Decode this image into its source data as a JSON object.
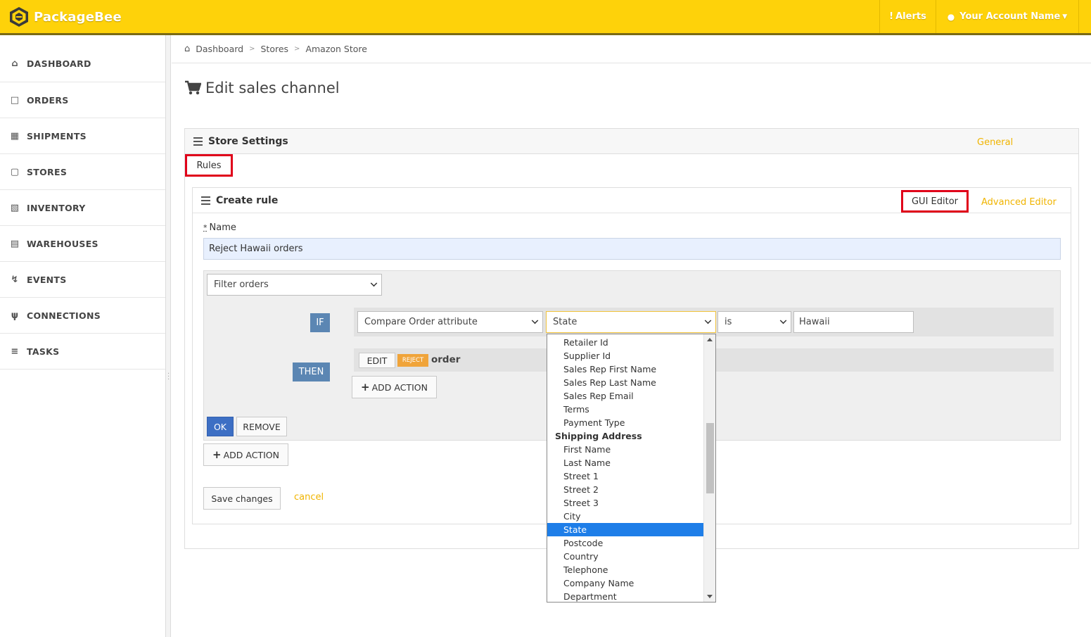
{
  "app": {
    "name": "PackageBee"
  },
  "topbar": {
    "alerts": "Alerts",
    "account": "Your Account Name"
  },
  "sidebar": {
    "items": [
      {
        "label": "DASHBOARD",
        "icon": "home-icon"
      },
      {
        "label": "ORDERS",
        "icon": "bag-icon"
      },
      {
        "label": "SHIPMENTS",
        "icon": "boxes-icon"
      },
      {
        "label": "STORES",
        "icon": "cart-icon"
      },
      {
        "label": "INVENTORY",
        "icon": "inventory-icon"
      },
      {
        "label": "WAREHOUSES",
        "icon": "warehouse-icon"
      },
      {
        "label": "EVENTS",
        "icon": "bolt-icon"
      },
      {
        "label": "CONNECTIONS",
        "icon": "plug-icon"
      },
      {
        "label": "TASKS",
        "icon": "list-icon"
      }
    ]
  },
  "breadcrumb": {
    "items": [
      "Dashboard",
      "Stores",
      "Amazon Store"
    ]
  },
  "page": {
    "title": "Edit sales channel"
  },
  "store_settings": {
    "title": "Store Settings",
    "tabs": {
      "general": "General",
      "rules": "Rules"
    }
  },
  "rule": {
    "title": "Create rule",
    "tabs": {
      "gui": "GUI Editor",
      "advanced": "Advanced Editor"
    },
    "name_label": "Name",
    "name_required_mark": "*",
    "name_value": "Reject Hawaii orders",
    "filter_select": "Filter orders",
    "if_label": "IF",
    "then_label": "THEN",
    "condition": {
      "attribute": "Compare Order attribute",
      "field": "State",
      "operator": "is",
      "value": "Hawaii"
    },
    "action": {
      "edit": "EDIT",
      "tag": "REJECT",
      "target": "order"
    },
    "add_action": "ADD ACTION",
    "ok": "OK",
    "remove": "REMOVE",
    "save": "Save changes",
    "cancel": "cancel"
  },
  "dropdown": {
    "options": [
      {
        "label": "Retailer Id",
        "group": false,
        "selected": false
      },
      {
        "label": "Supplier Id",
        "group": false,
        "selected": false
      },
      {
        "label": "Sales Rep First Name",
        "group": false,
        "selected": false
      },
      {
        "label": "Sales Rep Last Name",
        "group": false,
        "selected": false
      },
      {
        "label": "Sales Rep Email",
        "group": false,
        "selected": false
      },
      {
        "label": "Terms",
        "group": false,
        "selected": false
      },
      {
        "label": "Payment Type",
        "group": false,
        "selected": false
      },
      {
        "label": "Shipping Address",
        "group": true,
        "selected": false
      },
      {
        "label": "First Name",
        "group": false,
        "selected": false
      },
      {
        "label": "Last Name",
        "group": false,
        "selected": false
      },
      {
        "label": "Street 1",
        "group": false,
        "selected": false
      },
      {
        "label": "Street 2",
        "group": false,
        "selected": false
      },
      {
        "label": "Street 3",
        "group": false,
        "selected": false
      },
      {
        "label": "City",
        "group": false,
        "selected": false
      },
      {
        "label": "State",
        "group": false,
        "selected": true
      },
      {
        "label": "Postcode",
        "group": false,
        "selected": false
      },
      {
        "label": "Country",
        "group": false,
        "selected": false
      },
      {
        "label": "Telephone",
        "group": false,
        "selected": false
      },
      {
        "label": "Company Name",
        "group": false,
        "selected": false
      },
      {
        "label": "Department",
        "group": false,
        "selected": false
      }
    ]
  },
  "colors": {
    "brand": "#fed20a",
    "accent_link": "#f0b400",
    "highlight": "#e0001a",
    "selected": "#1e7ee8",
    "badge": "#5b86b3"
  }
}
